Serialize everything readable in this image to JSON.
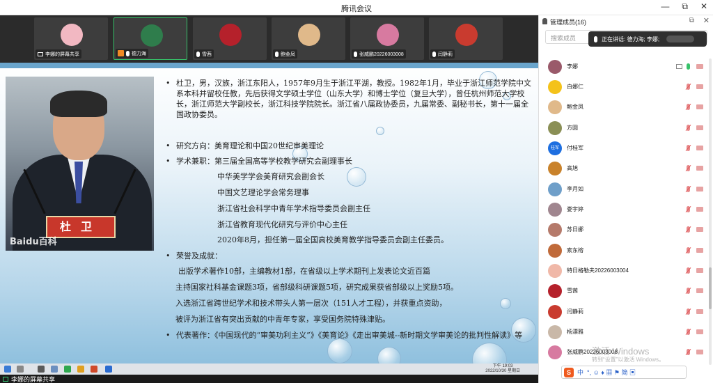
{
  "window": {
    "title": "腾讯会议",
    "controls": [
      "—",
      "⧉",
      "✕"
    ]
  },
  "participants_strip": [
    {
      "name": "李娜的屏幕共享",
      "avatar_color": "#f2b8c2",
      "icon": "screen-share-icon"
    },
    {
      "name": "德力海",
      "avatar_color": "#2f7d4c",
      "icon": "mic-icon",
      "host": true,
      "active": true
    },
    {
      "name": "雪茜",
      "avatar_color": "#b5212b",
      "icon": "mic-icon"
    },
    {
      "name": "鲍金凤",
      "avatar_color": "#e0b98a",
      "icon": "mic-icon"
    },
    {
      "name": "张威鹏20226003008",
      "avatar_color": "#d77aa0",
      "icon": "mic-icon"
    },
    {
      "name": "闫静莉",
      "avatar_color": "#c93b2f",
      "icon": "mic-icon"
    }
  ],
  "slide": {
    "photo_caption": "杜卫",
    "photo_watermark": "Baidu百科",
    "bio": "杜卫，男，汉族，浙江东阳人，1957年9月生于浙江平湖，教授。1982年1月，毕业于浙江师范学院中文系本科并留校任教，先后获得文学硕士学位（山东大学）和博士学位（复旦大学），曾任杭州师范大学校长，浙江师范大学副校长，浙江科技学院院长。浙江省八届政协委员，九届常委、副秘书长，第十一届全国政协委员。",
    "research": "研究方向：美育理论和中国20世纪审美理论",
    "academic_title": "学术兼职：第三届全国高等学校教学研究会副理事长",
    "academic_items": [
      "中华美学学会美育研究会副会长",
      "中国文艺理论学会常务理事",
      "浙江省社会科学中青年学术指导委员会副主任",
      "浙江省教育现代化研究与评价中心主任",
      "2020年8月，担任第一届全国高校美育教学指导委员会副主任委员。"
    ],
    "honors_title": "荣誉及成就：",
    "honors_items": [
      "出版学术著作10部，主编教材1部，在省级以上学术期刊上发表论文近百篇",
      "主持国家社科基金课题3项，省部级科研课题5项，研究成果获省部级以上奖励5项。",
      "入选浙江省跨世纪学术和技术带头人第一层次（151人才工程），并获重点资助，",
      "被评为浙江省有突出贡献的中青年专家，享受国务院特殊津贴。"
    ],
    "works": "代表著作：《中国现代的“审美功利主义”》《美育论》《走出审美城--新时期文学审美论的批判性解读》等"
  },
  "taskbar": {
    "time": "下午 19:03",
    "date": "2022/10/30 星期日"
  },
  "share_label": "李娜的屏幕共享",
  "panel": {
    "title": "管理成员(16)",
    "search_placeholder": "搜索成员",
    "speaking_label": "正在讲话: 德力海; 李娜;",
    "members": [
      {
        "name": "李娜",
        "avatar_color": "#9a5a6a",
        "mic": "on",
        "screen": true
      },
      {
        "name": "白娜仁",
        "avatar_color": "#f4c21a",
        "mic": "off"
      },
      {
        "name": "鲍金凤",
        "avatar_color": "#e0b98a",
        "mic": "off"
      },
      {
        "name": "方圆",
        "avatar_color": "#8a8f55",
        "mic": "off"
      },
      {
        "name": "付桂军",
        "avatar_color": "#1e6fe0",
        "avatar_text": "桂军",
        "mic": "off"
      },
      {
        "name": "高旭",
        "avatar_color": "#c9822b",
        "mic": "off"
      },
      {
        "name": "李月如",
        "avatar_color": "#6f9fc9",
        "mic": "off"
      },
      {
        "name": "娄宇婷",
        "avatar_color": "#a0868f",
        "mic": "off"
      },
      {
        "name": "苏日娜",
        "avatar_color": "#b57a6b",
        "mic": "off"
      },
      {
        "name": "索东榕",
        "avatar_color": "#c06a3a",
        "mic": "off"
      },
      {
        "name": "特日格勒夫20226003004",
        "avatar_color": "#f0b8a8",
        "mic": "off"
      },
      {
        "name": "雪茜",
        "avatar_color": "#b5212b",
        "mic": "off"
      },
      {
        "name": "闫静莉",
        "avatar_color": "#c93b2f",
        "mic": "off"
      },
      {
        "name": "杨漂雅",
        "avatar_color": "#c9b8a8",
        "mic": "off"
      },
      {
        "name": "张威鹏20226003008",
        "avatar_color": "#d77aa0",
        "mic": "off"
      }
    ]
  },
  "activation_watermark": {
    "line1": "激活 Windows",
    "line2": "转到“设置”以激活 Windows。"
  },
  "ime": {
    "label": "中",
    "symbols": "°, ☺ ♦ ▦ ⚑ 简 ▣"
  }
}
